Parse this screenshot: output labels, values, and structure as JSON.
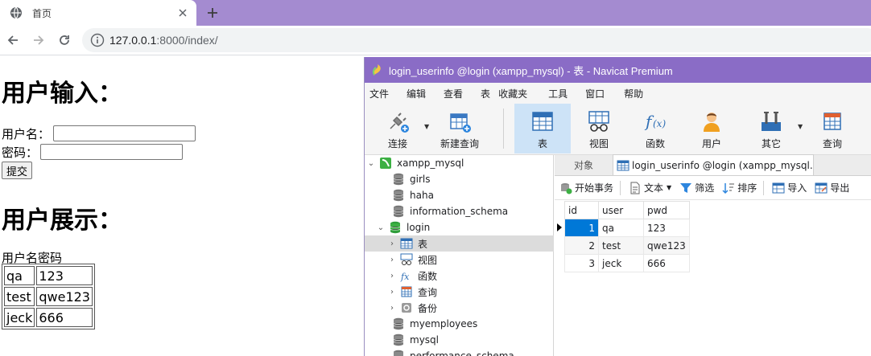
{
  "browser": {
    "tab_title": "首页",
    "url_host": "127.0.0.1",
    "url_rest": ":8000/index/"
  },
  "page": {
    "input_heading": "用户输入：",
    "username_label": "用户名：",
    "password_label": "密码：",
    "submit_label": "提交",
    "display_heading": "用户展示：",
    "table_caption": "用户名密码",
    "users": [
      {
        "user": "qa",
        "pwd": "123"
      },
      {
        "user": "test",
        "pwd": "qwe123"
      },
      {
        "user": "jeck",
        "pwd": "666"
      }
    ]
  },
  "navicat": {
    "title": "login_userinfo @login (xampp_mysql) - 表 - Navicat Premium",
    "menu": [
      "文件",
      "编辑",
      "查看",
      "表",
      "收藏夹",
      "工具",
      "窗口",
      "帮助"
    ],
    "toolbar": {
      "connect": "连接",
      "new_query": "新建查询",
      "table": "表",
      "view": "视图",
      "function": "函数",
      "user": "用户",
      "other": "其它",
      "query": "查询"
    },
    "tree": {
      "connection": "xampp_mysql",
      "databases_before": [
        "girls",
        "haha",
        "information_schema"
      ],
      "open_db": "login",
      "children": [
        "表",
        "视图",
        "函数",
        "查询",
        "备份"
      ],
      "databases_after": [
        "myemployees",
        "mysql",
        "performance_schema"
      ]
    },
    "tabs": {
      "objects": "对象",
      "data_tab": "login_userinfo @login (xampp_mysql..."
    },
    "subtoolbar": {
      "begin_tx": "开始事务",
      "text": "文本",
      "filter": "筛选",
      "sort": "排序",
      "import": "导入",
      "export": "导出"
    },
    "grid": {
      "columns": [
        "id",
        "user",
        "pwd"
      ],
      "rows": [
        {
          "id": "1",
          "user": "qa",
          "pwd": "123"
        },
        {
          "id": "2",
          "user": "test",
          "pwd": "qwe123"
        },
        {
          "id": "3",
          "user": "jeck",
          "pwd": "666"
        }
      ]
    }
  },
  "colors": {
    "chrome_accent": "#a48bd0",
    "navicat_title": "#8a6cc6",
    "selection": "#0078d7"
  }
}
